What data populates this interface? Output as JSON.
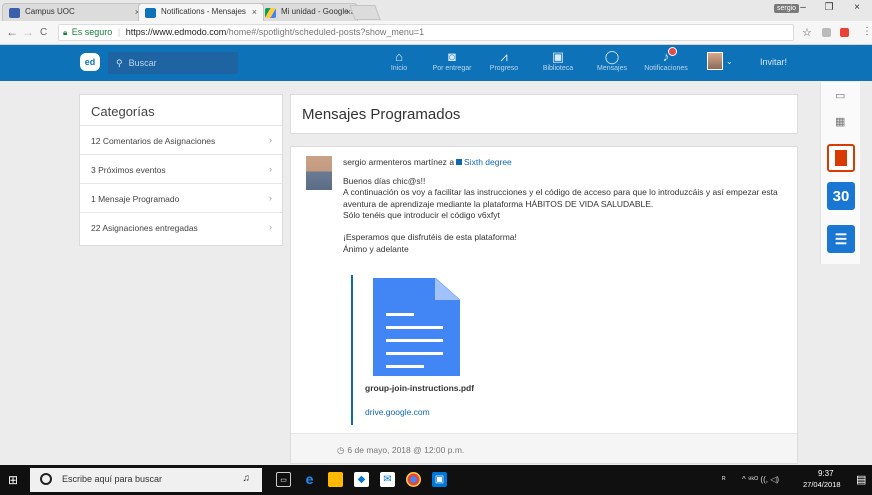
{
  "browser": {
    "tabs": [
      {
        "title": "Campus UOC",
        "active": false
      },
      {
        "title": "Notifications - Mensajes",
        "active": true
      },
      {
        "title": "Mi unidad - Google Drive",
        "active": false
      }
    ],
    "tab_close": "×",
    "profile_chip": "sergio",
    "window_controls": {
      "minimize": "–",
      "maximize": "❐",
      "close": "×"
    },
    "nav": {
      "back": "←",
      "forward": "→",
      "reload": "C"
    },
    "address": {
      "secure_label": "Es seguro",
      "url_host": "https://www.edmodo.com",
      "url_path": "/home#/spotlight/scheduled-posts?show_menu=1"
    },
    "star": "☆",
    "menu": "⋮"
  },
  "header": {
    "logo": "ed",
    "search_icon": "search-icon",
    "search_placeholder": "Buscar",
    "nav_items": [
      {
        "label": "Inicio",
        "icon": "home-icon",
        "glyph": "⌂"
      },
      {
        "label": "Por entregar",
        "icon": "inbox-icon",
        "glyph": "◙"
      },
      {
        "label": "Progreso",
        "icon": "progress-icon",
        "glyph": "⩘"
      },
      {
        "label": "Biblioteca",
        "icon": "library-icon",
        "glyph": "▣"
      },
      {
        "label": "Mensajes",
        "icon": "message-icon",
        "glyph": "◯"
      },
      {
        "label": "Notificaciones",
        "icon": "bell-icon",
        "glyph": "♪"
      }
    ],
    "caret": "⌄",
    "invite_label": "Invitar!"
  },
  "sidebar": {
    "title": "Categorías",
    "items": [
      {
        "label": "12 Comentarios de Asignaciones"
      },
      {
        "label": "3 Próximos eventos"
      },
      {
        "label": "1 Mensaje Programado"
      },
      {
        "label": "22 Asignaciones entregadas"
      }
    ],
    "chevron": "›"
  },
  "main": {
    "title": "Mensajes Programados",
    "post": {
      "author": "sergio armenteros martínez",
      "to_word": "a",
      "group": "Sixth degree",
      "lines": [
        "Buenos días chic@s!!",
        "A continuación os voy a facilitar las instrucciones y el código de acceso para que lo introduzcáis y así empezar esta",
        "aventura de aprendizaje mediante la plataforma HÁBITOS DE VIDA SALUDABLE.",
        "Sólo tenéis que introducir el código v6xfyt",
        "",
        "¡Esperamos que disfrutéis de esta plataforma!",
        "Ánimo y adelante"
      ],
      "attachment": {
        "name": "group-join-instructions.pdf",
        "source": "drive.google.com",
        "icon": "document-icon"
      },
      "scheduled": "6 de mayo, 2018 @ 12:00 p.m.",
      "clock_glyph": "◷"
    }
  },
  "rail": {
    "icons": [
      "printer-icon",
      "apps-grid-icon",
      "office-icon",
      "calendar-30-icon",
      "quiz-icon"
    ],
    "calendar_number": "30"
  },
  "taskbar": {
    "search_placeholder": "Escribe aquí para buscar",
    "time": "9:37",
    "date": "27/04/2018",
    "tray_text": "^ ⁹ᵏᴼ ((, ◁)",
    "colors": {
      "edge": "#1e90ff",
      "chrome": "#e8453c",
      "store": "#ffb900"
    }
  },
  "colors": {
    "brand_blue": "#0d72b8",
    "link_blue": "#1167b1",
    "doc_blue": "#4285f4",
    "office_red": "#d83b01"
  }
}
